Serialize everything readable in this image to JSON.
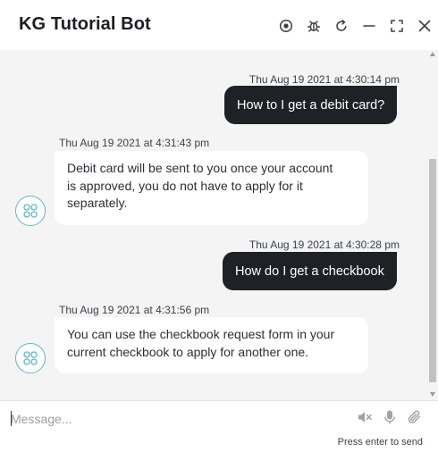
{
  "header": {
    "title": "KG Tutorial Bot",
    "icons": [
      "record-icon",
      "bug-icon",
      "refresh-icon",
      "minimize-icon",
      "expand-icon",
      "close-icon"
    ]
  },
  "messages": [
    {
      "sender": "user",
      "timestamp": "Thu Aug 19 2021 at 4:30:14 pm",
      "text": "How to I get a debit card?"
    },
    {
      "sender": "bot",
      "timestamp": "Thu Aug 19 2021 at 4:31:43 pm",
      "lines": [
        "Debit card will be sent to you once your account",
        "is approved, you do not have to apply for it",
        "separately."
      ]
    },
    {
      "sender": "user",
      "timestamp": "Thu Aug 19 2021 at 4:30:28 pm",
      "text": "How do I get a checkbook"
    },
    {
      "sender": "bot",
      "timestamp": "Thu Aug 19 2021 at 4:31:56 pm",
      "lines": [
        "You can use the checkbook request form in your",
        "current checkbook to apply for another one."
      ]
    }
  ],
  "composer": {
    "placeholder": "Message...",
    "hint": "Press enter to send",
    "icons": [
      "speaker-muted-icon",
      "microphone-icon",
      "paperclip-icon"
    ]
  },
  "colors": {
    "user_bubble": "#1e2226",
    "bot_bubble": "#ffffff",
    "chat_background": "#f4f4f5",
    "avatar_accent": "#5fb6c2"
  }
}
